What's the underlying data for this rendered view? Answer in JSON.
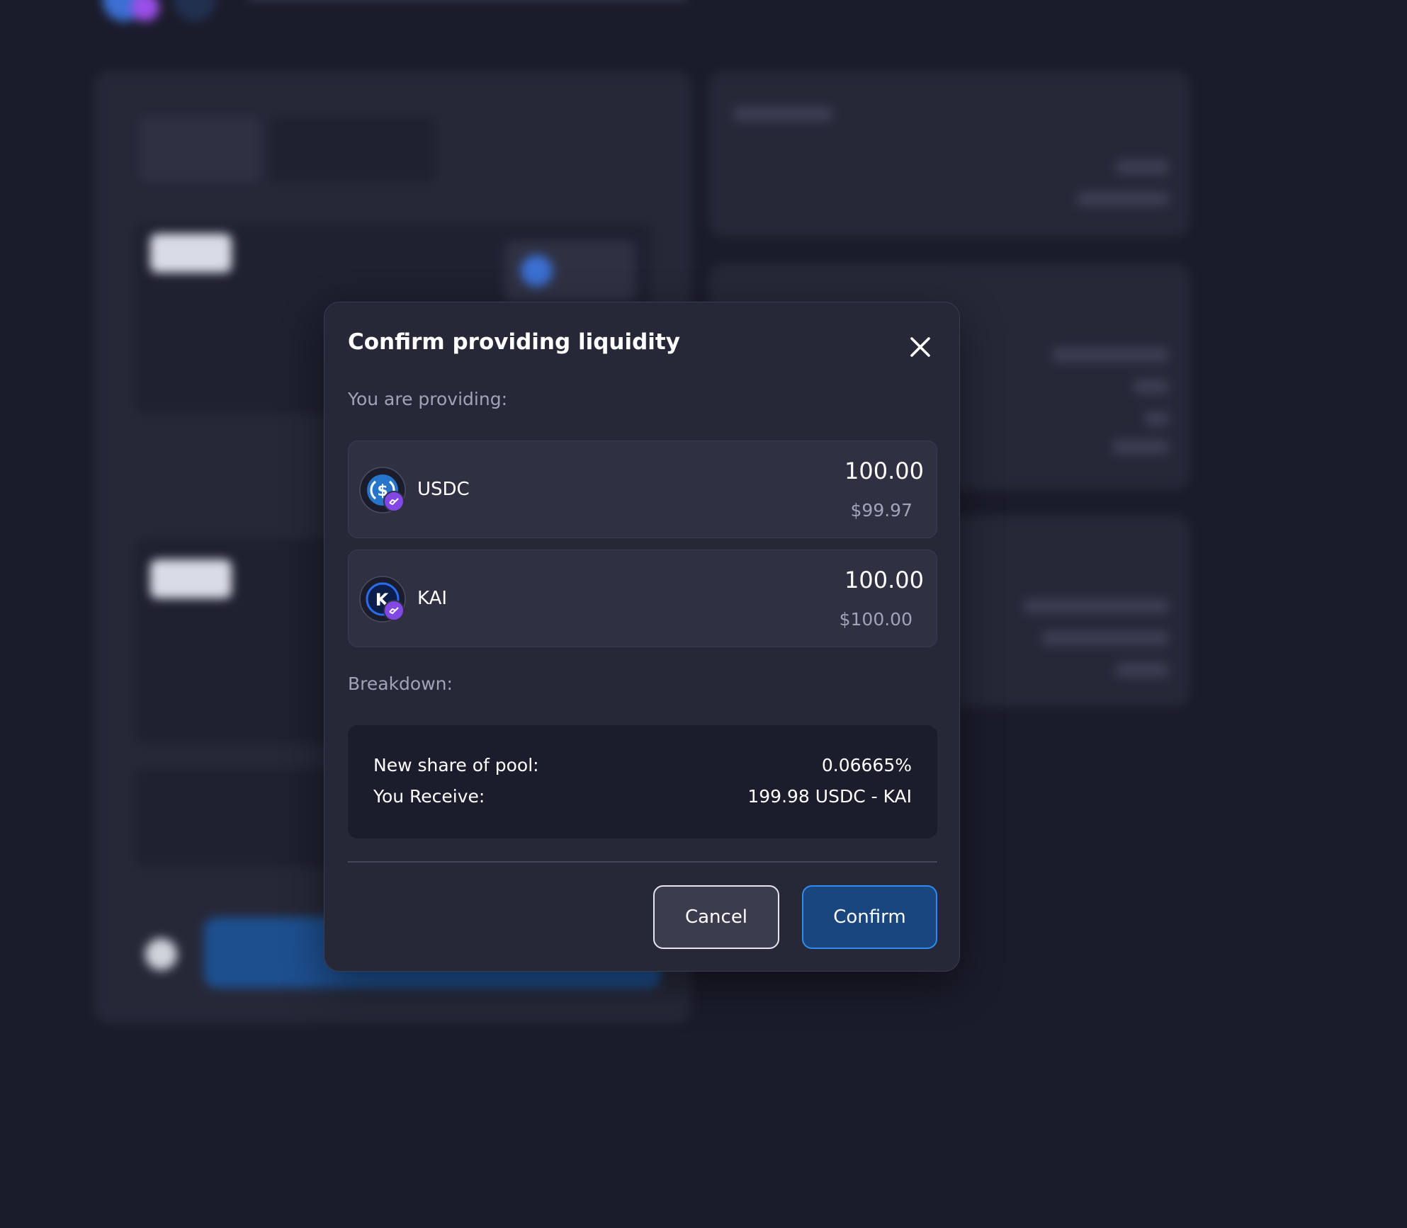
{
  "modal": {
    "title": "Confirm providing liquidity",
    "providing_label": "You are providing:",
    "tokens": [
      {
        "symbol": "USDC",
        "amount": "100.00",
        "usd_value": "$99.97",
        "icon": "usdc-coin-icon",
        "chain_badge": "polygon-badge-icon"
      },
      {
        "symbol": "KAI",
        "amount": "100.00",
        "usd_value": "$100.00",
        "icon": "kai-coin-icon",
        "chain_badge": "polygon-badge-icon"
      }
    ],
    "breakdown_label": "Breakdown:",
    "breakdown": [
      {
        "label": "New share of pool:",
        "value": "0.06665%"
      },
      {
        "label": "You Receive:",
        "value": "199.98 USDC - KAI"
      }
    ],
    "cancel_label": "Cancel",
    "confirm_label": "Confirm",
    "close_icon": "close-icon"
  },
  "colors": {
    "page_background": "#1b1c2b",
    "modal_background": "#262838",
    "token_row_background": "#2f3143",
    "breakdown_background": "#1c1d2c",
    "confirm_button": "#1a467f",
    "confirm_border": "#2e8cf0",
    "usdc_blue": "#2775ca",
    "polygon_purple": "#8247e5"
  }
}
